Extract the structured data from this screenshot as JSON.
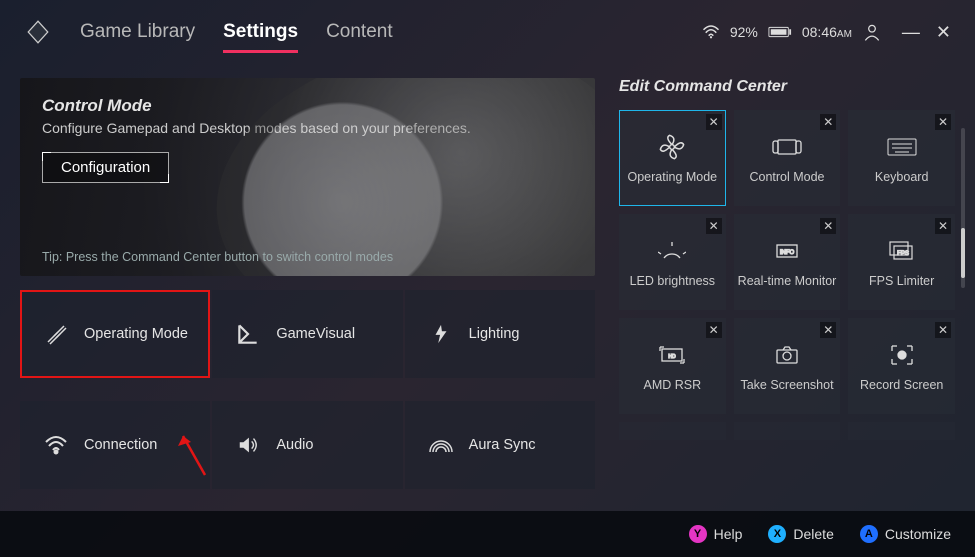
{
  "nav": {
    "tabs": [
      "Game Library",
      "Settings",
      "Content"
    ],
    "active_index": 1
  },
  "status": {
    "wifi_icon": "wifi",
    "battery_percent": "92%",
    "battery_icon": "battery",
    "time": "08:46",
    "ampm": "AM"
  },
  "hero": {
    "title": "Control Mode",
    "subtitle": "Configure Gamepad and Desktop modes based on your preferences.",
    "button_label": "Configuration",
    "tip": "Tip: Press the Command Center button to switch control modes"
  },
  "settings_grid": [
    {
      "label": "Operating Mode",
      "icon": "tools",
      "highlight": true
    },
    {
      "label": "GameVisual",
      "icon": "gvisual"
    },
    {
      "label": "Lighting",
      "icon": "bolt"
    },
    {
      "label": "Connection",
      "icon": "wifi"
    },
    {
      "label": "Audio",
      "icon": "speaker"
    },
    {
      "label": "Aura Sync",
      "icon": "rainbow"
    }
  ],
  "command_center": {
    "title": "Edit Command Center",
    "tiles": [
      {
        "label": "Operating Mode",
        "icon": "fan",
        "selected": true
      },
      {
        "label": "Control Mode",
        "icon": "handheld"
      },
      {
        "label": "Keyboard",
        "icon": "keyboard"
      },
      {
        "label": "LED brightness",
        "icon": "led"
      },
      {
        "label": "Real-time Monitor",
        "icon": "monitor"
      },
      {
        "label": "FPS Limiter",
        "icon": "fps"
      },
      {
        "label": "AMD RSR",
        "icon": "rsr"
      },
      {
        "label": "Take Screenshot",
        "icon": "camera"
      },
      {
        "label": "Record Screen",
        "icon": "record"
      }
    ],
    "plus_count": 3
  },
  "footer": {
    "help": "Help",
    "delete": "Delete",
    "customize": "Customize"
  }
}
